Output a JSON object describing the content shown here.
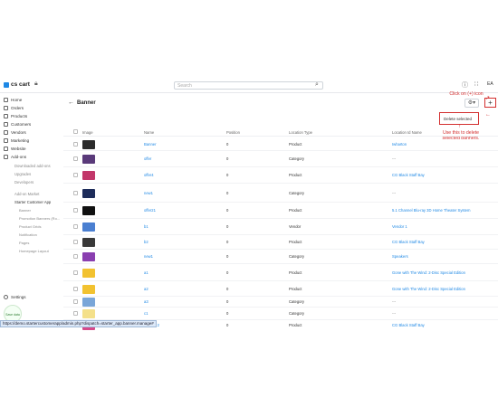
{
  "brand": {
    "logo_text": "cs cart"
  },
  "topbar": {
    "search_placeholder": "Search",
    "avatar_text": "EA"
  },
  "sidebar": {
    "items": [
      {
        "label": "Home"
      },
      {
        "label": "Orders"
      },
      {
        "label": "Products"
      },
      {
        "label": "Customers"
      },
      {
        "label": "Vendors"
      },
      {
        "label": "Marketing"
      },
      {
        "label": "Website"
      },
      {
        "label": "Add-ons"
      }
    ],
    "addon_subitems": [
      {
        "label": "Downloaded add-ons"
      },
      {
        "label": "Upgrades"
      },
      {
        "label": "Developers"
      }
    ],
    "addon_links": [
      {
        "label": "Add-on Market"
      },
      {
        "label": "Starter Customer App"
      }
    ],
    "app_subitems": [
      {
        "label": "Banner"
      },
      {
        "label": "Promotion Banners (Ro..."
      },
      {
        "label": "Product Grids"
      },
      {
        "label": "Notification"
      },
      {
        "label": "Pages"
      },
      {
        "label": "Homepage Layout"
      }
    ],
    "settings_label": "Settings",
    "badge_text": "Save data"
  },
  "page": {
    "title": "Banner",
    "dropdown_item": "Delete selected",
    "callout_top": "Click on (+) icon",
    "callout_bottom": "Use this to delete selected banners."
  },
  "table": {
    "headers": [
      "Image",
      "Name",
      "Position",
      "Location Type",
      "Location Id Name"
    ],
    "rows": [
      {
        "name": "Banner",
        "position": "0",
        "type": "Product",
        "loc": "Iwharton",
        "thumb": "#2b2b2b"
      },
      {
        "name": "offer",
        "position": "0",
        "type": "Category",
        "loc": "---",
        "thumb": "#5a3a7a"
      },
      {
        "name": "offer4",
        "position": "0",
        "type": "Product",
        "loc": "CG Black Staff Bay",
        "thumb": "#c2376a"
      },
      {
        "name": "new1",
        "position": "0",
        "type": "Category",
        "loc": "---",
        "thumb": "#1d2c5a"
      },
      {
        "name": "offer21",
        "position": "0",
        "type": "Product",
        "loc": "5.1 Channel Blu-ray 3D Home Theater System",
        "thumb": "#111111"
      },
      {
        "name": "b1",
        "position": "0",
        "type": "Vendor",
        "loc": "Vendor 1",
        "thumb": "#4a7fd1"
      },
      {
        "name": "b2",
        "position": "0",
        "type": "Product",
        "loc": "CG Black Staff Bay",
        "thumb": "#383838"
      },
      {
        "name": "new1",
        "position": "0",
        "type": "Category",
        "loc": "Speakers",
        "thumb": "#8a3fb0"
      },
      {
        "name": "a1",
        "position": "0",
        "type": "Product",
        "loc": "Gone with The Wind: 2-Disc Special Edition",
        "thumb": "#f2c230"
      },
      {
        "name": "a2",
        "position": "0",
        "type": "Product",
        "loc": "Gone with The Wind: 2-Disc Special Edition",
        "thumb": "#f2c230"
      },
      {
        "name": "a3",
        "position": "0",
        "type": "Category",
        "loc": "---",
        "thumb": "#7aa6d8"
      },
      {
        "name": "c1",
        "position": "0",
        "type": "Category",
        "loc": "---",
        "thumb": "#f4e08a"
      },
      {
        "name": "Banner 2",
        "position": "0",
        "type": "Product",
        "loc": "CG Black Staff Bay",
        "thumb": "#d64a8a"
      }
    ]
  },
  "status_url": "https://demo.startercustomerapp/admin.php?dispatch=starter_app.banner.manage#"
}
